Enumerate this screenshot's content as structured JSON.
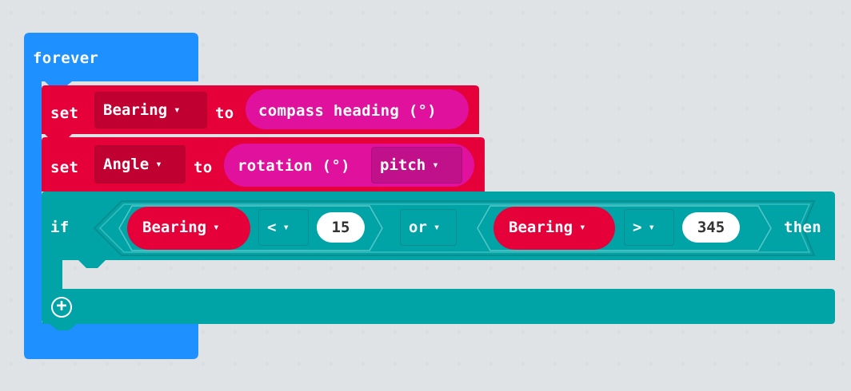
{
  "colors": {
    "loop": "#1e90ff",
    "variables": "#e6003a",
    "input": "#e0129d",
    "logic": "#00a4a6",
    "workspace": "#ecf0f1"
  },
  "forever_block": {
    "label": "forever"
  },
  "set_bearing": {
    "set_label": "set",
    "variable": "Bearing",
    "to_label": "to",
    "value": "compass heading (°)"
  },
  "set_angle": {
    "set_label": "set",
    "variable": "Angle",
    "to_label": "to",
    "value": "rotation (°)",
    "option": "pitch"
  },
  "if_block": {
    "if_label": "if",
    "left": {
      "variable": "Bearing",
      "operator": "<",
      "number": "15"
    },
    "logic_operator": "or",
    "right": {
      "variable": "Bearing",
      "operator": ">",
      "number": "345"
    },
    "then_label": "then",
    "add_icon": "plus-circle-icon"
  },
  "caret_symbol": "▾"
}
